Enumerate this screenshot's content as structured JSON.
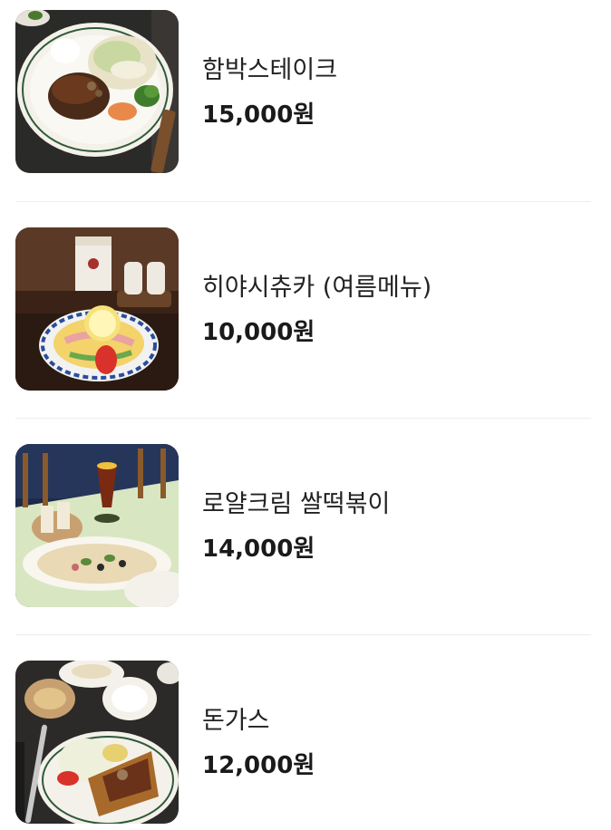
{
  "menu": {
    "items": [
      {
        "name": "함박스테이크",
        "price": "15,000원",
        "image": "hamburg-steak-photo"
      },
      {
        "name": "히야시츄카 (여름메뉴)",
        "price": "10,000원",
        "image": "hiyashi-chuka-photo"
      },
      {
        "name": "로얄크림 쌀떡볶이",
        "price": "14,000원",
        "image": "cream-tteokbokki-photo"
      },
      {
        "name": "돈가스",
        "price": "12,000원",
        "image": "tonkatsu-photo"
      }
    ]
  }
}
